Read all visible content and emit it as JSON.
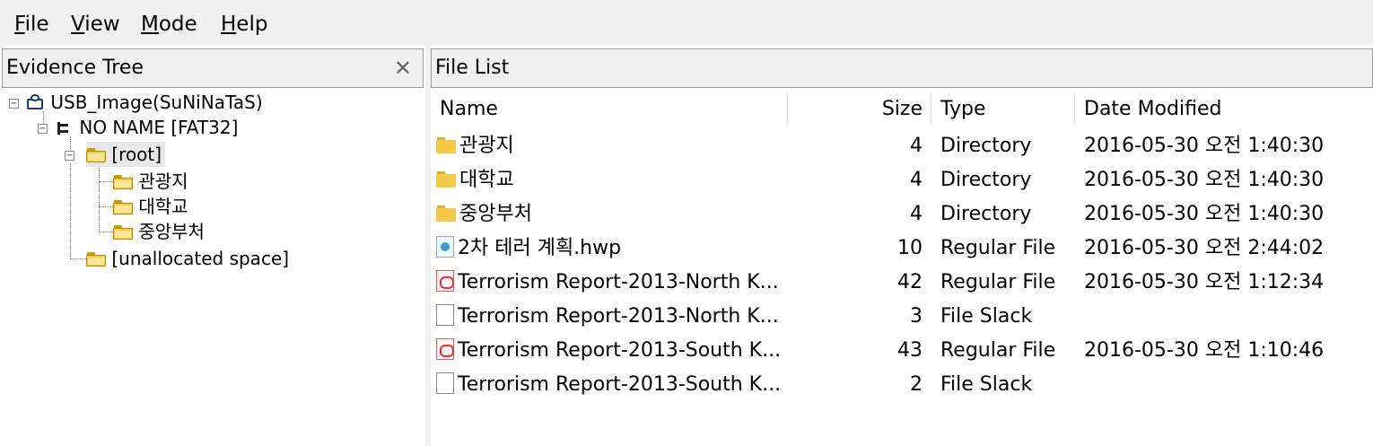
{
  "menu": [
    {
      "label": "File",
      "accel": "F",
      "rest": "ile"
    },
    {
      "label": "View",
      "accel": "V",
      "rest": "iew"
    },
    {
      "label": "Mode",
      "accel": "M",
      "rest": "ode"
    },
    {
      "label": "Help",
      "accel": "H",
      "rest": "elp"
    }
  ],
  "evidence_tree": {
    "title": "Evidence Tree",
    "close_glyph": "✕",
    "nodes": [
      {
        "label": "USB_Image(SuNiNaTaS)",
        "icon": "evidence-image-icon"
      },
      {
        "label": "NO NAME [FAT32]",
        "icon": "volume-icon"
      },
      {
        "label": "[root]",
        "icon": "folder-icon"
      },
      {
        "label": "관광지",
        "icon": "folder-icon"
      },
      {
        "label": "대학교",
        "icon": "folder-icon"
      },
      {
        "label": "중앙부처",
        "icon": "folder-icon"
      },
      {
        "label": "[unallocated space]",
        "icon": "folder-icon"
      }
    ]
  },
  "file_list": {
    "title": "File List",
    "columns": {
      "name": "Name",
      "size": "Size",
      "type": "Type",
      "date": "Date Modified"
    },
    "rows": [
      {
        "name": "관광지",
        "size": "4",
        "type": "Directory",
        "date": "2016-05-30 오전 1:40:30",
        "icon": "folder-icon"
      },
      {
        "name": "대학교",
        "size": "4",
        "type": "Directory",
        "date": "2016-05-30 오전 1:40:30",
        "icon": "folder-icon"
      },
      {
        "name": "중앙부처",
        "size": "4",
        "type": "Directory",
        "date": "2016-05-30 오전 1:40:30",
        "icon": "folder-icon"
      },
      {
        "name": "2차 테러 계획.hwp",
        "size": "10",
        "type": "Regular File",
        "date": "2016-05-30 오전 2:44:02",
        "icon": "hwp-file-icon"
      },
      {
        "name": "Terrorism Report-2013-North  K...",
        "size": "42",
        "type": "Regular File",
        "date": "2016-05-30 오전 1:12:34",
        "icon": "pdf-file-icon"
      },
      {
        "name": "Terrorism Report-2013-North  K...",
        "size": "3",
        "type": "File Slack",
        "date": "",
        "icon": "blank-file-icon"
      },
      {
        "name": "Terrorism Report-2013-South K...",
        "size": "43",
        "type": "Regular File",
        "date": "2016-05-30 오전 1:10:46",
        "icon": "pdf-file-icon"
      },
      {
        "name": "Terrorism Report-2013-South K...",
        "size": "2",
        "type": "File Slack",
        "date": "",
        "icon": "blank-file-icon"
      }
    ]
  }
}
